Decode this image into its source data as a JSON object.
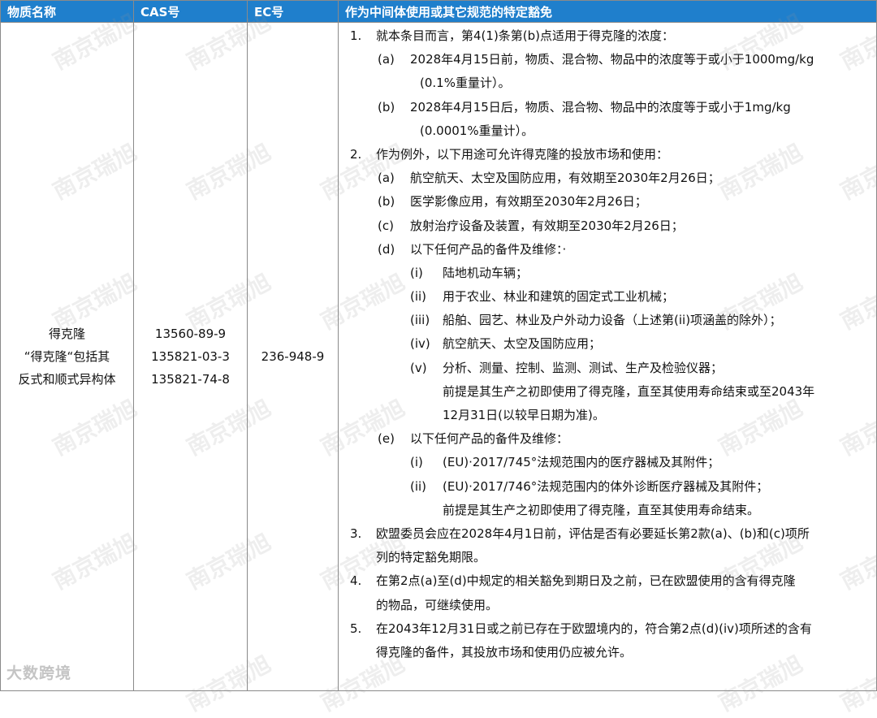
{
  "headers": [
    "物质名称",
    "CAS号",
    "EC号",
    "作为中间体使用或其它规范的特定豁免"
  ],
  "substance": {
    "name_lines": [
      "得克隆",
      "“得克隆“包括其",
      "反式和顺式异构体"
    ]
  },
  "cas_numbers": [
    "13560-89-9",
    "135821-03-3",
    "135821-74-8"
  ],
  "ec_number": "236-948-9",
  "lines": [
    {
      "m": "1.",
      "t": "就本条目而言，第4(1)条第(b)点适用于得克隆的浓度："
    },
    {
      "m": "(a)",
      "t": "2028年4月15日前，物质、混合物、物品中的浓度等于或小于1000mg/kg"
    },
    {
      "m": "",
      "t": "(0.1%重量计）。"
    },
    {
      "m": "(b)",
      "t": "2028年4月15日后，物质、混合物、物品中的浓度等于或小于1mg/kg"
    },
    {
      "m": "",
      "t": "(0.0001%重量计）。"
    },
    {
      "m": "2.",
      "t": "作为例外，以下用途可允许得克隆的投放市场和使用："
    },
    {
      "m": "(a)",
      "t": "航空航天、太空及国防应用，有效期至2030年2月26日；"
    },
    {
      "m": "(b)",
      "t": "医学影像应用，有效期至2030年2月26日；"
    },
    {
      "m": "(c)",
      "t": "放射治疗设备及装置，有效期至2030年2月26日；"
    },
    {
      "m": "(d)",
      "t": "以下任何产品的备件及维修：·"
    },
    {
      "m": "(i)",
      "t": "陆地机动车辆；"
    },
    {
      "m": "(ii)",
      "t": "用于农业、林业和建筑的固定式工业机械；"
    },
    {
      "m": "(iii)",
      "t": "船舶、园艺、林业及户外动力设备（上述第(ii)项涵盖的除外）；"
    },
    {
      "m": "(iv)",
      "t": "航空航天、太空及国防应用；"
    },
    {
      "m": "(v)",
      "t": "分析、测量、控制、监测、测试、生产及检验仪器；"
    },
    {
      "m": "",
      "t": "前提是其生产之初即使用了得克隆，直至其使用寿命结束或至2043年"
    },
    {
      "m": "",
      "t": "12月31日(以较早日期为准)。"
    },
    {
      "m": "(e)",
      "t": "以下任何产品的备件及维修："
    },
    {
      "m": "(i)",
      "t": "(EU)·2017/745°法规范围内的医疗器械及其附件；"
    },
    {
      "m": "(ii)",
      "t": "(EU)·2017/746°法规范围内的体外诊断医疗器械及其附件；"
    },
    {
      "m": "",
      "t": "前提是其生产之初即使用了得克隆，直至其使用寿命结束。"
    },
    {
      "m": "3.",
      "t": "欧盟委员会应在2028年4月1日前，评估是否有必要延长第2款(a)、(b)和(c)项所"
    },
    {
      "m": "",
      "t": "列的特定豁免期限。"
    },
    {
      "m": "4.",
      "t": "在第2点(a)至(d)中规定的相关豁免到期日及之前，已在欧盟使用的含有得克隆"
    },
    {
      "m": "",
      "t": "的物品，可继续使用。"
    },
    {
      "m": "5.",
      "t": "在2043年12月31日或之前已存在于欧盟境内的，符合第2点(d)(iv)项所述的含有"
    },
    {
      "m": "",
      "t": "得克隆的备件，其投放市场和使用仍应被允许。"
    }
  ],
  "watermark": "南京瑞旭",
  "logo": "大数跨境",
  "colors": {
    "header_bg": "#1f7fcc",
    "header_text": "#ffffff",
    "border": "#8a8a8a"
  }
}
